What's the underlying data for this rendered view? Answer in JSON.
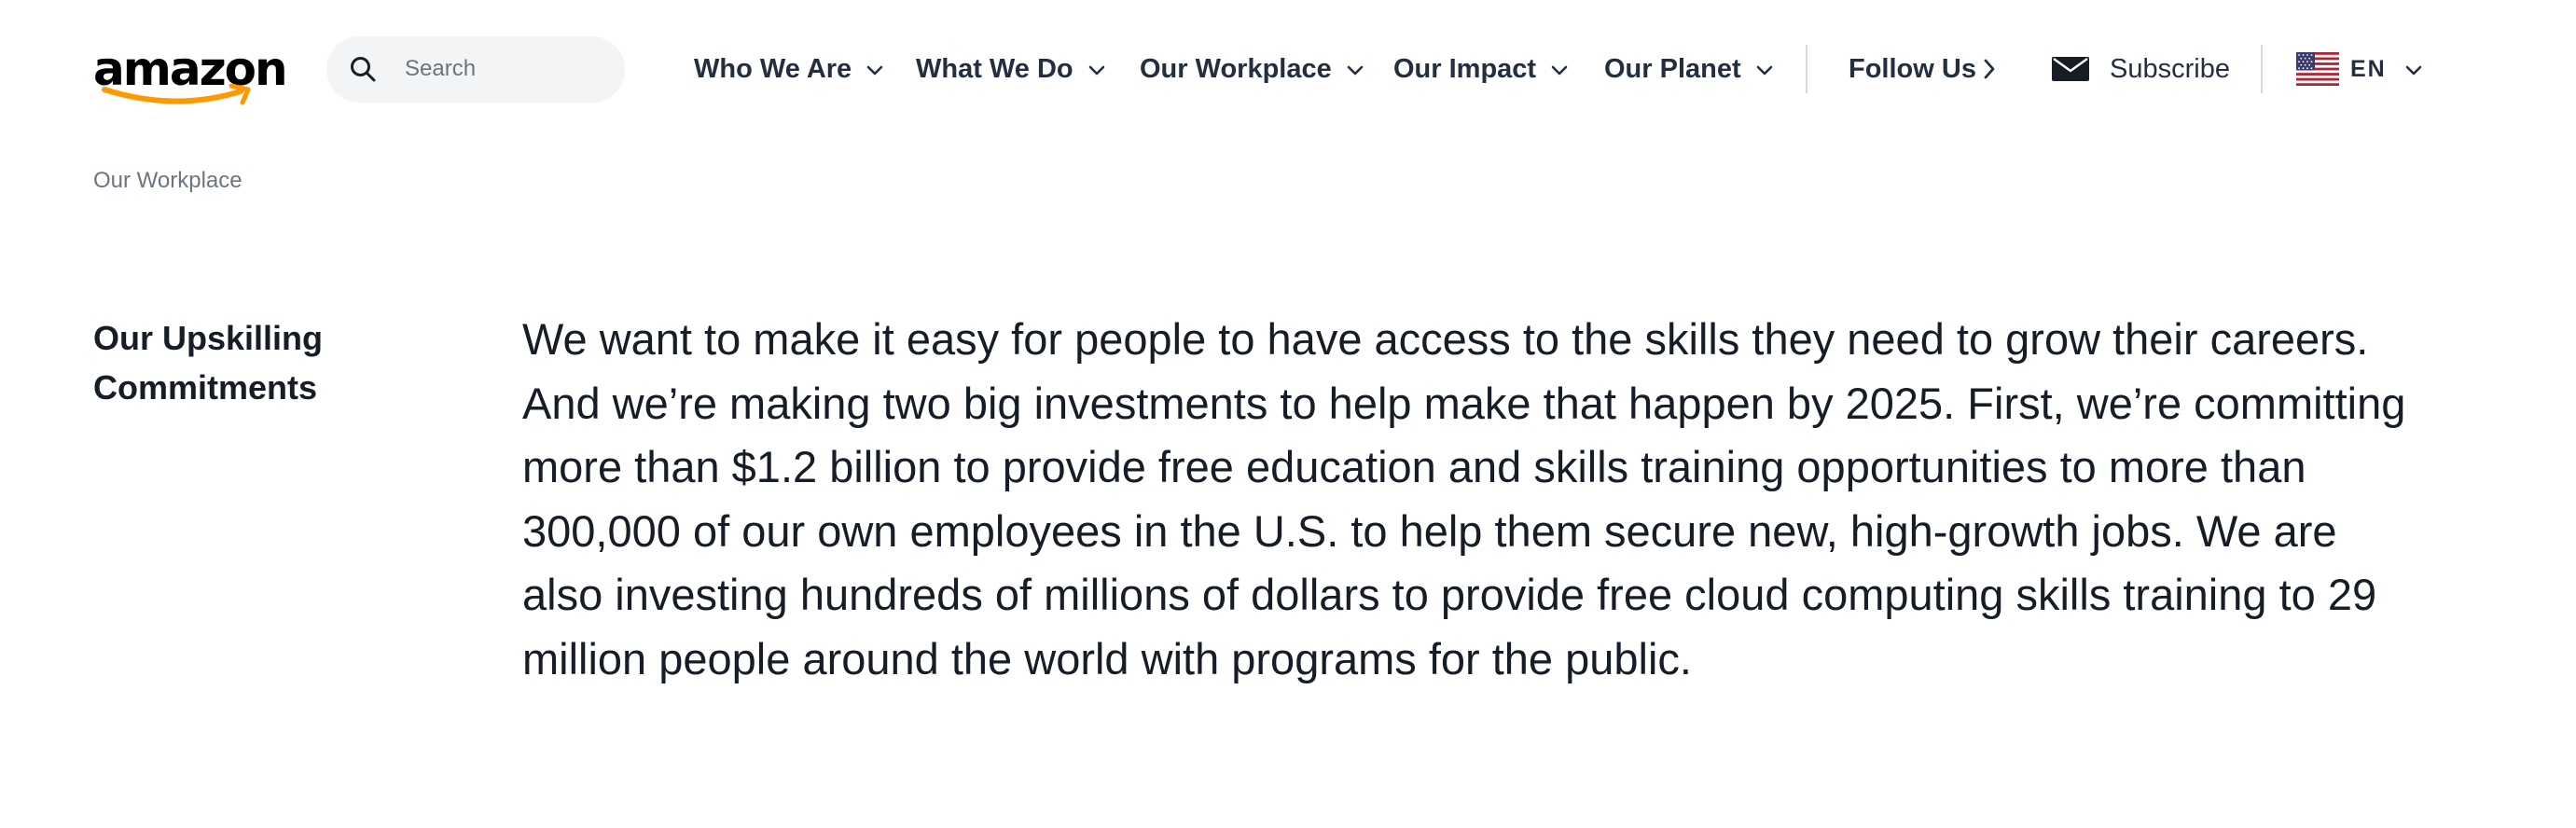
{
  "header": {
    "logo": {
      "text": "amazon",
      "smile_color": "#ff9900"
    },
    "search": {
      "placeholder": "Search",
      "value": "",
      "icon": "search-icon"
    },
    "nav": [
      {
        "label": "Who We Are",
        "icon": "chevron-down-icon"
      },
      {
        "label": "What We Do",
        "icon": "chevron-down-icon"
      },
      {
        "label": "Our Workplace",
        "icon": "chevron-down-icon"
      },
      {
        "label": "Our Impact",
        "icon": "chevron-down-icon"
      },
      {
        "label": "Our Planet",
        "icon": "chevron-down-icon"
      }
    ],
    "follow": {
      "label": "Follow Us",
      "icon": "chevron-right-icon"
    },
    "subscribe": {
      "label": "Subscribe",
      "icon": "mail-icon"
    },
    "language": {
      "label": "EN",
      "icon": "us-flag-icon"
    }
  },
  "breadcrumb": {
    "label": "Our Workplace"
  },
  "section": {
    "title": "Our Upskilling Commitments",
    "body": "We want to make it easy for people to have access to the skills they need to grow their careers. And we’re making two big investments to help make that happen by 2025. First, we’re committing more than $1.2 billion to provide free education and skills training opportunities to more than 300,000 of our own employees in the U.S. to help them secure new, high-growth jobs. We are also investing hundreds of millions of dollars to provide free cloud computing skills training to 29 million people around the world with programs for the public."
  },
  "colors": {
    "text": "#161d26",
    "nav_text": "#232f3e",
    "muted": "#6b7480",
    "search_bg": "#f2f4f5",
    "accent": "#ff9900"
  }
}
